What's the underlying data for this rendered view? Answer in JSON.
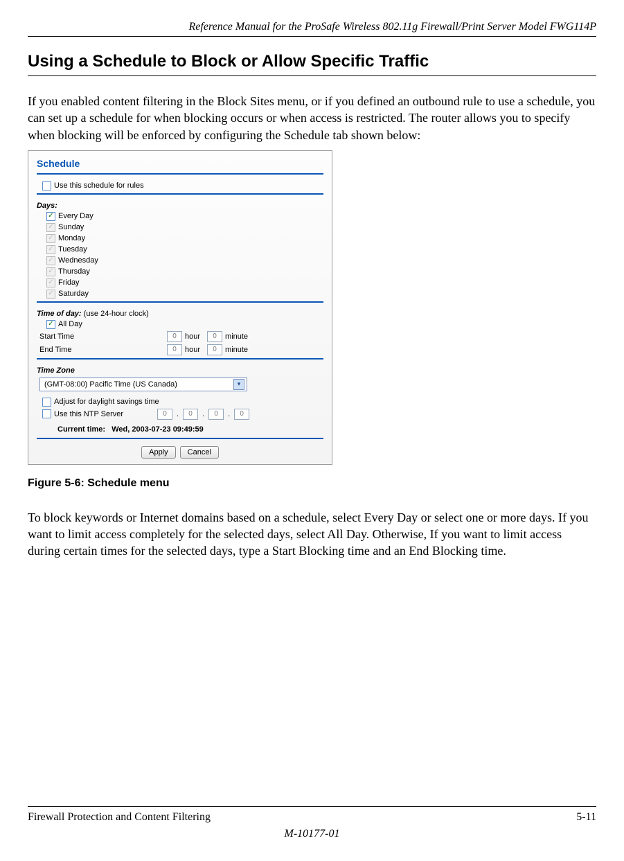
{
  "meta": {
    "running_header": "Reference Manual for the ProSafe Wireless 802.11g  Firewall/Print Server Model FWG114P",
    "section_title": "Using a Schedule to Block or Allow Specific Traffic",
    "figure_caption": "Figure 5-6:  Schedule menu",
    "footer_left": "Firewall Protection and Content Filtering",
    "footer_right": "5-11",
    "doc_number": "M-10177-01"
  },
  "body": {
    "p1": "If you enabled content filtering in the Block Sites menu, or if you defined an outbound rule to use a schedule, you can set up a schedule for when blocking occurs or when access is restricted. The router allows you to specify when blocking will be enforced by configuring the Schedule tab shown below:",
    "p2": "To block keywords or Internet domains based on a schedule, select Every Day or select one or more days. If you want to limit access completely for the selected days, select All Day. Otherwise, If you want to limit access during certain times for the selected days, type a Start Blocking time and an End Blocking time."
  },
  "shot": {
    "title": "Schedule",
    "use_schedule_label": "Use this schedule for rules",
    "use_schedule_checked": false,
    "days_title": "Days:",
    "days": [
      {
        "label": "Every Day",
        "checked": true,
        "disabled": false
      },
      {
        "label": "Sunday",
        "checked": true,
        "disabled": true
      },
      {
        "label": "Monday",
        "checked": true,
        "disabled": true
      },
      {
        "label": "Tuesday",
        "checked": true,
        "disabled": true
      },
      {
        "label": "Wednesday",
        "checked": true,
        "disabled": true
      },
      {
        "label": "Thursday",
        "checked": true,
        "disabled": true
      },
      {
        "label": "Friday",
        "checked": true,
        "disabled": true
      },
      {
        "label": "Saturday",
        "checked": true,
        "disabled": true
      }
    ],
    "time_title": "Time of day:",
    "time_note": " (use 24-hour clock)",
    "allday_label": "All Day",
    "allday_checked": true,
    "start_label": "Start Time",
    "end_label": "End Time",
    "hour_unit": "hour",
    "minute_unit": "minute",
    "start_hour": "0",
    "start_min": "0",
    "end_hour": "0",
    "end_min": "0",
    "tz_title": "Time Zone",
    "tz_value": "(GMT-08:00) Pacific Time (US Canada)",
    "dst_label": "Adjust for daylight savings time",
    "dst_checked": false,
    "ntp_label": "Use this NTP Server",
    "ntp_checked": false,
    "ntp_ip": [
      "0",
      "0",
      "0",
      "0"
    ],
    "curtime_label": "Current time:",
    "curtime_value": "Wed, 2003-07-23 09:49:59",
    "apply_label": "Apply",
    "cancel_label": "Cancel"
  }
}
